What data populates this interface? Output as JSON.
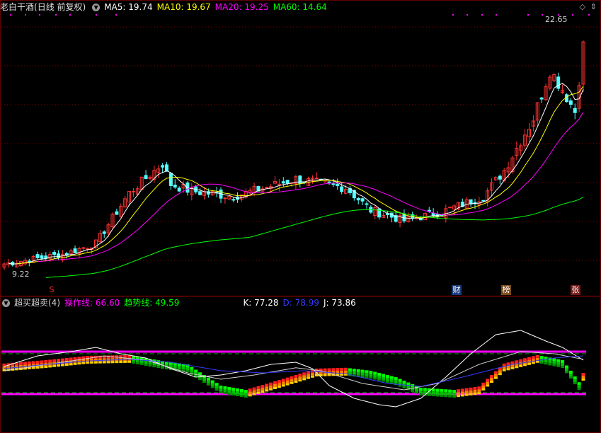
{
  "main_panel": {
    "stock_name": "老白干酒",
    "period": "(日线 前复权)",
    "ma": [
      {
        "label": "MA5: 19.74",
        "color": "#ffffff"
      },
      {
        "label": "MA10: 19.67",
        "color": "#ffff00"
      },
      {
        "label": "MA20: 19.25",
        "color": "#ff00ff"
      },
      {
        "label": "MA60: 14.64",
        "color": "#00ff00"
      }
    ],
    "high_label": "22.65",
    "low_label": "9.22",
    "markers": [
      {
        "label": "S",
        "color": "#ff3030"
      },
      {
        "label": "财",
        "color": "#ffffff",
        "bg": "#1a3a7a"
      },
      {
        "label": "榜",
        "color": "#ffffff",
        "bg": "#7a4a1a"
      },
      {
        "label": "张",
        "color": "#ffffff",
        "bg": "#7a1a1a"
      }
    ]
  },
  "sub_panel": {
    "title": "超买超卖(4)",
    "op_line": "操作线: 66.60",
    "trend_line": "趋势线: 49.59",
    "k": "K: 77.28",
    "d": "D: 78.99",
    "j": "J: 73.86",
    "colors": {
      "op": "#ff00ff",
      "trend": "#00ff00",
      "k": "#ffffff",
      "d": "#3a3aff",
      "j": "#ffffff"
    }
  },
  "colors": {
    "up": "#ff3232",
    "down": "#54ffff",
    "grid": "#8b0000",
    "divider": "#b00000",
    "band": "#ff00ff"
  }
}
